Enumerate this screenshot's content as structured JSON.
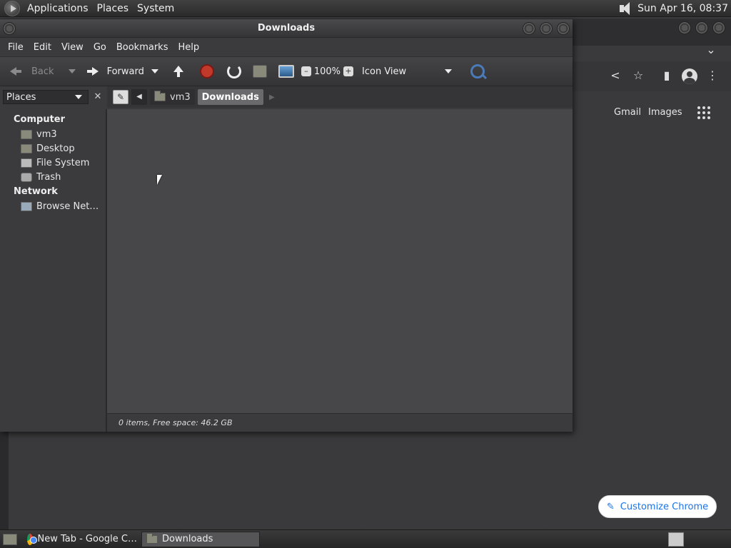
{
  "top_panel": {
    "menus": [
      "Applications",
      "Places",
      "System"
    ],
    "clock": "Sun Apr 16, 08:37"
  },
  "chrome": {
    "links": {
      "gmail": "Gmail",
      "images": "Images"
    },
    "customize_label": "Customize Chrome"
  },
  "file_manager": {
    "title": "Downloads",
    "menubar": [
      "File",
      "Edit",
      "View",
      "Go",
      "Bookmarks",
      "Help"
    ],
    "toolbar": {
      "back": "Back",
      "forward": "Forward",
      "zoom": "100%",
      "view_mode": "Icon View"
    },
    "sidebar_select": "Places",
    "pathbar": [
      "vm3",
      "Downloads"
    ],
    "sidebar": {
      "computer_heading": "Computer",
      "computer_items": [
        "vm3",
        "Desktop",
        "File System",
        "Trash"
      ],
      "network_heading": "Network",
      "network_items": [
        "Browse Net…"
      ]
    },
    "status": "0 items, Free space: 46.2 GB"
  },
  "taskbar": {
    "items": [
      "New Tab - Google C…",
      "Downloads"
    ]
  }
}
